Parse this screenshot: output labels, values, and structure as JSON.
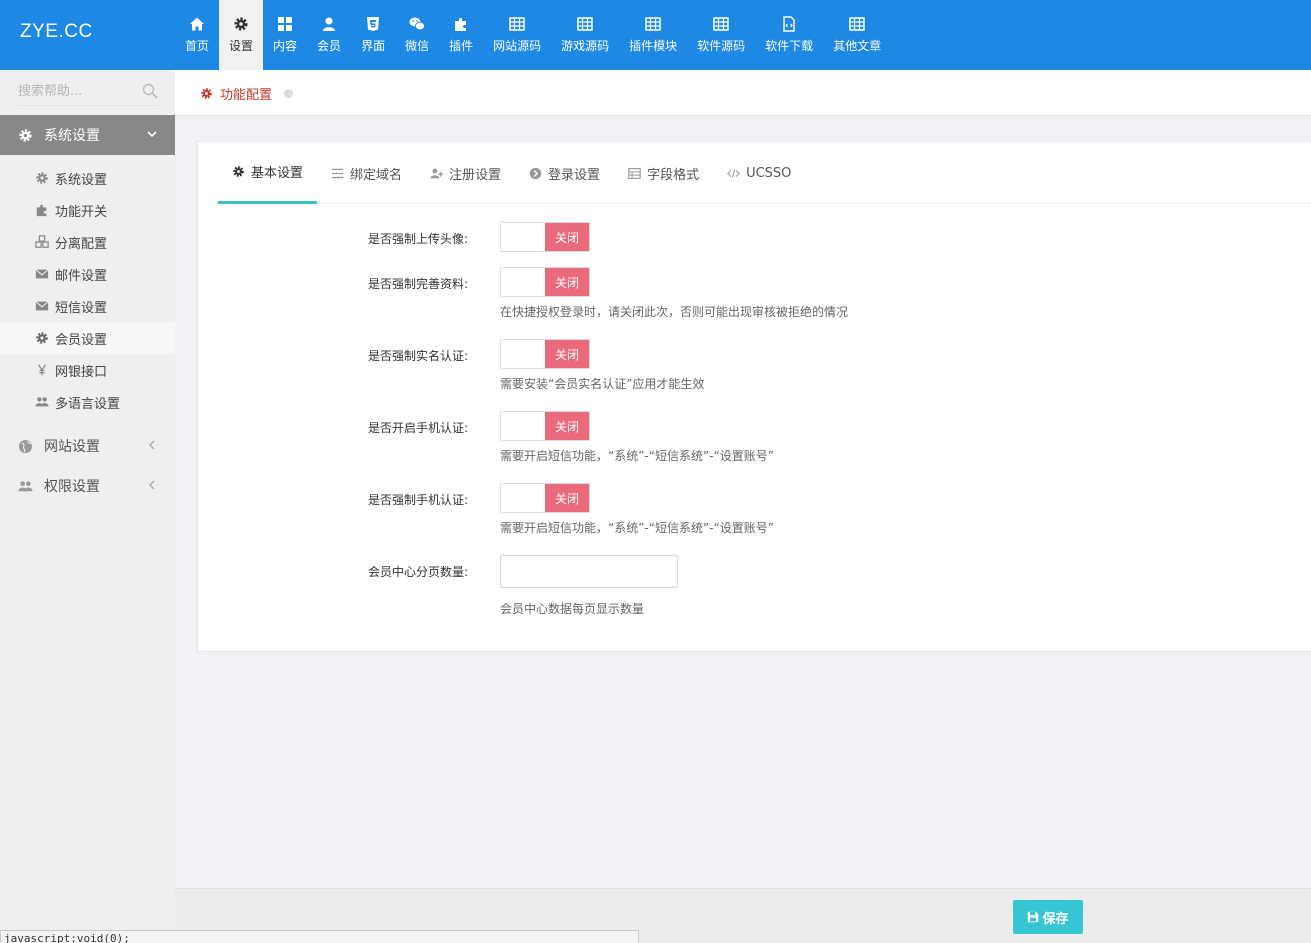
{
  "brand": "ZYE.CC",
  "topnav": [
    {
      "label": "首页",
      "icon": "home-icon",
      "active": false
    },
    {
      "label": "设置",
      "icon": "gear-icon",
      "active": true
    },
    {
      "label": "内容",
      "icon": "grid-icon",
      "active": false
    },
    {
      "label": "会员",
      "icon": "user-icon",
      "active": false
    },
    {
      "label": "界面",
      "icon": "html5-icon",
      "active": false
    },
    {
      "label": "微信",
      "icon": "wechat-icon",
      "active": false
    },
    {
      "label": "插件",
      "icon": "puzzle-icon",
      "active": false
    },
    {
      "label": "网站源码",
      "icon": "table-icon",
      "active": false
    },
    {
      "label": "游戏源码",
      "icon": "table-icon",
      "active": false
    },
    {
      "label": "插件模块",
      "icon": "table-icon",
      "active": false
    },
    {
      "label": "软件源码",
      "icon": "table-icon",
      "active": false
    },
    {
      "label": "软件下载",
      "icon": "file-code-icon",
      "active": false
    },
    {
      "label": "其他文章",
      "icon": "table-icon",
      "active": false
    }
  ],
  "sidebar": {
    "search_placeholder": "搜索帮助...",
    "system_settings": "系统设置",
    "sub_items": [
      {
        "label": "系统设置",
        "icon": "gear-icon"
      },
      {
        "label": "功能开关",
        "icon": "puzzle-icon"
      },
      {
        "label": "分离配置",
        "icon": "cubes-icon"
      },
      {
        "label": "邮件设置",
        "icon": "envelope-icon"
      },
      {
        "label": "短信设置",
        "icon": "envelope-icon"
      },
      {
        "label": "会员设置",
        "icon": "gear-icon"
      },
      {
        "label": "网银接口",
        "icon": "yen-icon"
      },
      {
        "label": "多语言设置",
        "icon": "users-icon"
      }
    ],
    "site_settings": "网站设置",
    "permission_settings": "权限设置"
  },
  "breadcrumb": "功能配置",
  "tabs": [
    {
      "label": "基本设置",
      "icon": "gear-icon"
    },
    {
      "label": "绑定域名",
      "icon": "list-icon"
    },
    {
      "label": "注册设置",
      "icon": "user-plus-icon"
    },
    {
      "label": "登录设置",
      "icon": "chevron-circle-icon"
    },
    {
      "label": "字段格式",
      "icon": "table-list-icon"
    },
    {
      "label": "UCSSO",
      "icon": "code-icon"
    }
  ],
  "form": {
    "avatar": {
      "label": "是否强制上传头像:",
      "state": "关闭"
    },
    "profile": {
      "label": "是否强制完善资料:",
      "state": "关闭",
      "help": "在快捷授权登录时，请关闭此次，否则可能出现审核被拒绝的情况"
    },
    "realname": {
      "label": "是否强制实名认证:",
      "state": "关闭",
      "help": "需要安装“会员实名认证”应用才能生效"
    },
    "mobile_open": {
      "label": "是否开启手机认证:",
      "state": "关闭",
      "help": "需要开启短信功能，“系统”-“短信系统”-“设置账号”"
    },
    "mobile_force": {
      "label": "是否强制手机认证:",
      "state": "关闭",
      "help": "需要开启短信功能，“系统”-“短信系统”-“设置账号”"
    },
    "pagesize": {
      "label": "会员中心分页数量:",
      "value": "",
      "help": "会员中心数据每页显示数量"
    }
  },
  "save_label": "保存",
  "status_text": "javascript:void(0);",
  "colors": {
    "topbar": "#1e88e5",
    "toggle_off": "#e96b7b",
    "save": "#36c6d3",
    "tab_active": "#3bbfc8",
    "crumb": "#c0392b"
  }
}
